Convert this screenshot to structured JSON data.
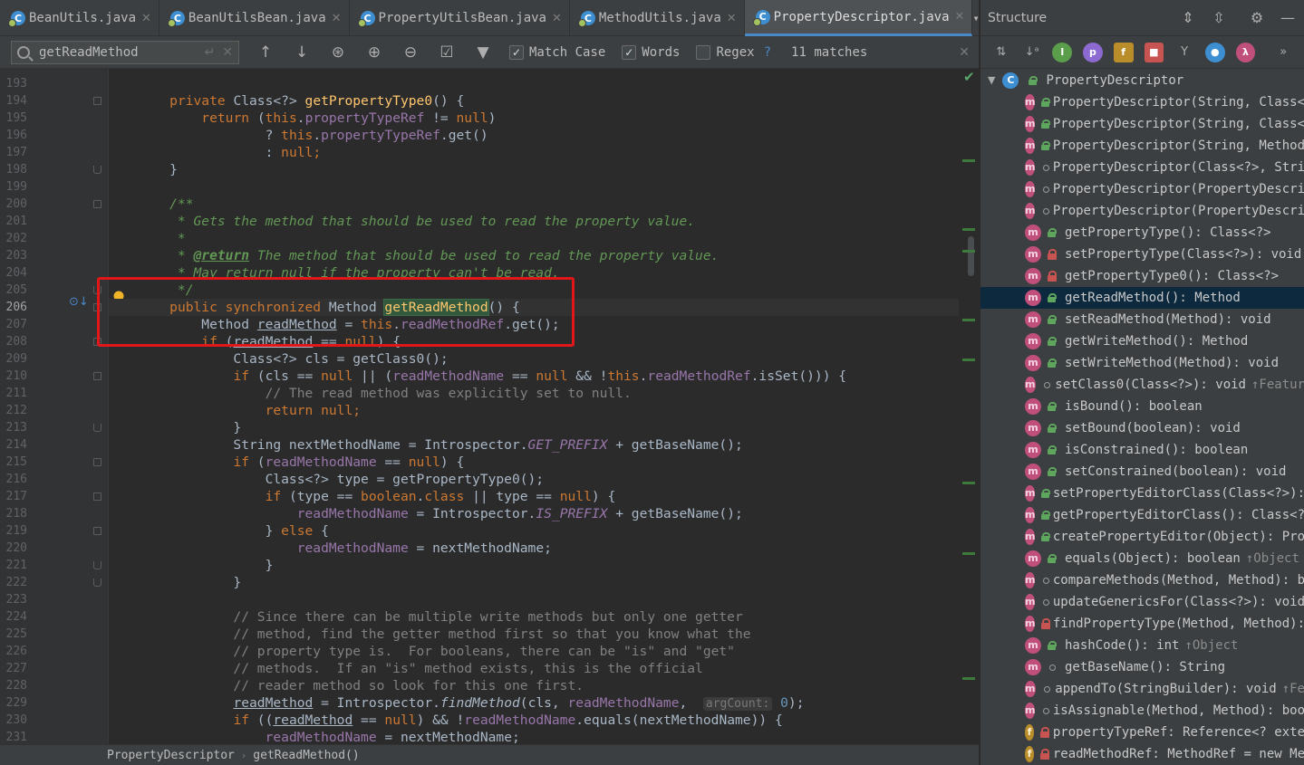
{
  "tabs": [
    {
      "label": "BeanUtils.java",
      "active": false,
      "icon": "class-icon"
    },
    {
      "label": "BeanUtilsBean.java",
      "active": false,
      "icon": "class-icon"
    },
    {
      "label": "PropertyUtilsBean.java",
      "active": false,
      "icon": "class-icon"
    },
    {
      "label": "MethodUtils.java",
      "active": false,
      "icon": "class-icon"
    },
    {
      "label": "PropertyDescriptor.java",
      "active": true,
      "icon": "class-icon"
    }
  ],
  "tab_overflow_label": "▾≡₂",
  "find": {
    "query": "getReadMethod",
    "match_case_label": "Match Case",
    "match_case_checked": true,
    "words_label": "Words",
    "words_checked": true,
    "regex_label": "Regex",
    "regex_checked": false,
    "regex_help": "?",
    "matches": "11 matches"
  },
  "editor": {
    "current_line": 206,
    "lines": [
      {
        "n": 193,
        "code": []
      },
      {
        "n": 194,
        "code": [
          [
            "    ",
            ""
          ],
          [
            "private ",
            "kw"
          ],
          [
            "Class<?> ",
            ""
          ],
          [
            "getPropertyType0",
            "fn"
          ],
          [
            "() {",
            ""
          ]
        ]
      },
      {
        "n": 195,
        "code": [
          [
            "        ",
            ""
          ],
          [
            "return ",
            "kw"
          ],
          [
            "(",
            ""
          ],
          [
            "this",
            "kw"
          ],
          [
            ".",
            ""
          ],
          [
            "propertyTypeRef",
            "fld"
          ],
          [
            " != ",
            ""
          ],
          [
            "null",
            "kw"
          ],
          [
            ")",
            ""
          ]
        ]
      },
      {
        "n": 196,
        "code": [
          [
            "                ? ",
            ""
          ],
          [
            "this",
            "kw"
          ],
          [
            ".",
            ""
          ],
          [
            "propertyTypeRef",
            "fld"
          ],
          [
            ".get()",
            ""
          ]
        ]
      },
      {
        "n": 197,
        "code": [
          [
            "                : ",
            ""
          ],
          [
            "null",
            "kw"
          ],
          [
            ";",
            "kw"
          ]
        ]
      },
      {
        "n": 198,
        "code": [
          [
            "    }",
            ""
          ]
        ]
      },
      {
        "n": 199,
        "code": []
      },
      {
        "n": 200,
        "code": [
          [
            "    /**",
            "dc"
          ]
        ]
      },
      {
        "n": 201,
        "code": [
          [
            "     * Gets the method that should be used to read the property value.",
            "dc"
          ]
        ]
      },
      {
        "n": 202,
        "code": [
          [
            "     *",
            "dc"
          ]
        ]
      },
      {
        "n": 203,
        "code": [
          [
            "     * ",
            "dc"
          ],
          [
            "@return",
            "dtag"
          ],
          [
            " The method that should be used to read the property value.",
            "dc"
          ]
        ]
      },
      {
        "n": 204,
        "code": [
          [
            "     * May return null if the property can't be read.",
            "dc"
          ]
        ]
      },
      {
        "n": 205,
        "code": [
          [
            "     */",
            "dc"
          ]
        ]
      },
      {
        "n": 206,
        "code": [
          [
            "    ",
            ""
          ],
          [
            "public synchronized ",
            "kw"
          ],
          [
            "Method ",
            ""
          ],
          [
            "getReadMethod",
            "hl"
          ],
          [
            "() {",
            ""
          ]
        ]
      },
      {
        "n": 207,
        "code": [
          [
            "        Method ",
            ""
          ],
          [
            "readMethod",
            "ul"
          ],
          [
            " = ",
            ""
          ],
          [
            "this",
            "kw"
          ],
          [
            ".",
            ""
          ],
          [
            "readMethodRef",
            "fld"
          ],
          [
            ".get();",
            ""
          ]
        ]
      },
      {
        "n": 208,
        "code": [
          [
            "        ",
            ""
          ],
          [
            "if ",
            "kw"
          ],
          [
            "(",
            ""
          ],
          [
            "readMethod",
            "ul"
          ],
          [
            " == ",
            ""
          ],
          [
            "null",
            "kw"
          ],
          [
            ") {",
            ""
          ]
        ]
      },
      {
        "n": 209,
        "code": [
          [
            "            Class<?> cls = getClass0();",
            ""
          ]
        ]
      },
      {
        "n": 210,
        "code": [
          [
            "            ",
            ""
          ],
          [
            "if ",
            "kw"
          ],
          [
            "(cls == ",
            ""
          ],
          [
            "null",
            "kw"
          ],
          [
            " || (",
            ""
          ],
          [
            "readMethodName",
            "fld"
          ],
          [
            " == ",
            ""
          ],
          [
            "null",
            "kw"
          ],
          [
            " && !",
            ""
          ],
          [
            "this",
            "kw"
          ],
          [
            ".",
            ""
          ],
          [
            "readMethodRef",
            "fld"
          ],
          [
            ".isSet())) {",
            ""
          ]
        ]
      },
      {
        "n": 211,
        "code": [
          [
            "                // The read method was explicitly set to null.",
            "cm"
          ]
        ]
      },
      {
        "n": 212,
        "code": [
          [
            "                ",
            ""
          ],
          [
            "return null",
            "kw"
          ],
          [
            ";",
            "kw"
          ]
        ]
      },
      {
        "n": 213,
        "code": [
          [
            "            }",
            ""
          ]
        ]
      },
      {
        "n": 214,
        "code": [
          [
            "            String nextMethodName = Introspector.",
            ""
          ],
          [
            "GET_PREFIX",
            "stc"
          ],
          [
            " + getBaseName();",
            ""
          ]
        ]
      },
      {
        "n": 215,
        "code": [
          [
            "            ",
            ""
          ],
          [
            "if ",
            "kw"
          ],
          [
            "(",
            ""
          ],
          [
            "readMethodName",
            "fld"
          ],
          [
            " == ",
            ""
          ],
          [
            "null",
            "kw"
          ],
          [
            ") {",
            ""
          ]
        ]
      },
      {
        "n": 216,
        "code": [
          [
            "                Class<?> type = getPropertyType0();",
            ""
          ]
        ]
      },
      {
        "n": 217,
        "code": [
          [
            "                ",
            ""
          ],
          [
            "if ",
            "kw"
          ],
          [
            "(type == ",
            ""
          ],
          [
            "boolean",
            "kw"
          ],
          [
            ".",
            ""
          ],
          [
            "class",
            "kw"
          ],
          [
            " || type == ",
            ""
          ],
          [
            "null",
            "kw"
          ],
          [
            ") {",
            ""
          ]
        ]
      },
      {
        "n": 218,
        "code": [
          [
            "                    ",
            ""
          ],
          [
            "readMethodName",
            "fld"
          ],
          [
            " = Introspector.",
            ""
          ],
          [
            "IS_PREFIX",
            "stc"
          ],
          [
            " + getBaseName();",
            ""
          ]
        ]
      },
      {
        "n": 219,
        "code": [
          [
            "                } ",
            ""
          ],
          [
            "else ",
            "kw"
          ],
          [
            "{",
            ""
          ]
        ]
      },
      {
        "n": 220,
        "code": [
          [
            "                    ",
            ""
          ],
          [
            "readMethodName",
            "fld"
          ],
          [
            " = nextMethodName;",
            ""
          ]
        ]
      },
      {
        "n": 221,
        "code": [
          [
            "                }",
            ""
          ]
        ]
      },
      {
        "n": 222,
        "code": [
          [
            "            }",
            ""
          ]
        ]
      },
      {
        "n": 223,
        "code": []
      },
      {
        "n": 224,
        "code": [
          [
            "            // Since there can be multiple write methods but only one getter",
            "cm"
          ]
        ]
      },
      {
        "n": 225,
        "code": [
          [
            "            // method, find the getter method first so that you know what the",
            "cm"
          ]
        ]
      },
      {
        "n": 226,
        "code": [
          [
            "            // property type is.  For booleans, there can be \"is\" and \"get\"",
            "cm"
          ]
        ]
      },
      {
        "n": 227,
        "code": [
          [
            "            // methods.  If an \"is\" method exists, this is the official",
            "cm"
          ]
        ]
      },
      {
        "n": 228,
        "code": [
          [
            "            // reader method so look for this one first.",
            "cm"
          ]
        ]
      },
      {
        "n": 229,
        "code": [
          [
            "            ",
            ""
          ],
          [
            "readMethod",
            "ul"
          ],
          [
            " = Introspector.",
            ""
          ],
          [
            "findMethod",
            "it"
          ],
          [
            "(cls, ",
            ""
          ],
          [
            "readMethodName",
            "fld"
          ],
          [
            ",  ",
            ""
          ],
          [
            "argCount:",
            "hint"
          ],
          [
            " ",
            ""
          ],
          [
            "0",
            "num"
          ],
          [
            ");",
            ""
          ]
        ]
      },
      {
        "n": 230,
        "code": [
          [
            "            ",
            ""
          ],
          [
            "if ",
            "kw"
          ],
          [
            "((",
            ""
          ],
          [
            "readMethod",
            "ul"
          ],
          [
            " == ",
            ""
          ],
          [
            "null",
            "kw"
          ],
          [
            ") && !",
            ""
          ],
          [
            "readMethodName",
            "fld"
          ],
          [
            ".equals(nextMethodName)) {",
            ""
          ]
        ]
      },
      {
        "n": 231,
        "code": [
          [
            "                ",
            ""
          ],
          [
            "readMethodName",
            "fld"
          ],
          [
            " = nextMethodName;",
            ""
          ]
        ]
      }
    ]
  },
  "breadcrumb": [
    "PropertyDescriptor",
    "getReadMethod()"
  ],
  "structure": {
    "title": "Structure",
    "root": "PropertyDescriptor",
    "selected_index": 9,
    "items": [
      {
        "kind": "m",
        "vis": "pub",
        "label": "PropertyDescriptor(String, Class<",
        "extra": ""
      },
      {
        "kind": "m",
        "vis": "pub",
        "label": "PropertyDescriptor(String, Class<",
        "extra": ""
      },
      {
        "kind": "m",
        "vis": "pub",
        "label": "PropertyDescriptor(String, Method",
        "extra": ""
      },
      {
        "kind": "m",
        "vis": "pkg",
        "label": "PropertyDescriptor(Class<?>, Stri",
        "extra": ""
      },
      {
        "kind": "m",
        "vis": "pkg",
        "label": "PropertyDescriptor(PropertyDescri",
        "extra": ""
      },
      {
        "kind": "m",
        "vis": "pkg",
        "label": "PropertyDescriptor(PropertyDescri",
        "extra": ""
      },
      {
        "kind": "m",
        "vis": "pub",
        "label": "getPropertyType(): Class<?>",
        "extra": ""
      },
      {
        "kind": "m",
        "vis": "priv",
        "label": "setPropertyType(Class<?>): void",
        "extra": ""
      },
      {
        "kind": "m",
        "vis": "priv",
        "label": "getPropertyType0(): Class<?>",
        "extra": ""
      },
      {
        "kind": "m",
        "vis": "pub",
        "label": "getReadMethod(): Method",
        "extra": ""
      },
      {
        "kind": "m",
        "vis": "pub",
        "label": "setReadMethod(Method): void",
        "extra": ""
      },
      {
        "kind": "m",
        "vis": "pub",
        "label": "getWriteMethod(): Method",
        "extra": ""
      },
      {
        "kind": "m",
        "vis": "pub",
        "label": "setWriteMethod(Method): void",
        "extra": ""
      },
      {
        "kind": "m",
        "vis": "pkg",
        "label": "setClass0(Class<?>): void",
        "extra": "↑Featur"
      },
      {
        "kind": "m",
        "vis": "pub",
        "label": "isBound(): boolean",
        "extra": ""
      },
      {
        "kind": "m",
        "vis": "pub",
        "label": "setBound(boolean): void",
        "extra": ""
      },
      {
        "kind": "m",
        "vis": "pub",
        "label": "isConstrained(): boolean",
        "extra": ""
      },
      {
        "kind": "m",
        "vis": "pub",
        "label": "setConstrained(boolean): void",
        "extra": ""
      },
      {
        "kind": "m",
        "vis": "pub",
        "label": "setPropertyEditorClass(Class<?>):",
        "extra": ""
      },
      {
        "kind": "m",
        "vis": "pub",
        "label": "getPropertyEditorClass(): Class<?",
        "extra": ""
      },
      {
        "kind": "m",
        "vis": "pub",
        "label": "createPropertyEditor(Object): Pro",
        "extra": ""
      },
      {
        "kind": "m",
        "vis": "pub",
        "label": "equals(Object): boolean",
        "extra": "↑Object"
      },
      {
        "kind": "m",
        "vis": "pkg",
        "label": "compareMethods(Method, Method): b",
        "extra": ""
      },
      {
        "kind": "m",
        "vis": "pkg",
        "label": "updateGenericsFor(Class<?>): void",
        "extra": ""
      },
      {
        "kind": "m",
        "vis": "priv",
        "label": "findPropertyType(Method, Method):",
        "extra": ""
      },
      {
        "kind": "m",
        "vis": "pub",
        "label": "hashCode(): int",
        "extra": "↑Object"
      },
      {
        "kind": "m",
        "vis": "pkg",
        "label": "getBaseName(): String",
        "extra": ""
      },
      {
        "kind": "m",
        "vis": "pkg",
        "label": "appendTo(StringBuilder): void",
        "extra": "↑Fe"
      },
      {
        "kind": "m",
        "vis": "pkg",
        "label": "isAssignable(Method, Method): boo",
        "extra": ""
      },
      {
        "kind": "f",
        "vis": "priv",
        "label": "propertyTypeRef: Reference<? exte",
        "extra": ""
      },
      {
        "kind": "f",
        "vis": "priv",
        "label": "readMethodRef: MethodRef = new Me",
        "extra": ""
      }
    ]
  }
}
